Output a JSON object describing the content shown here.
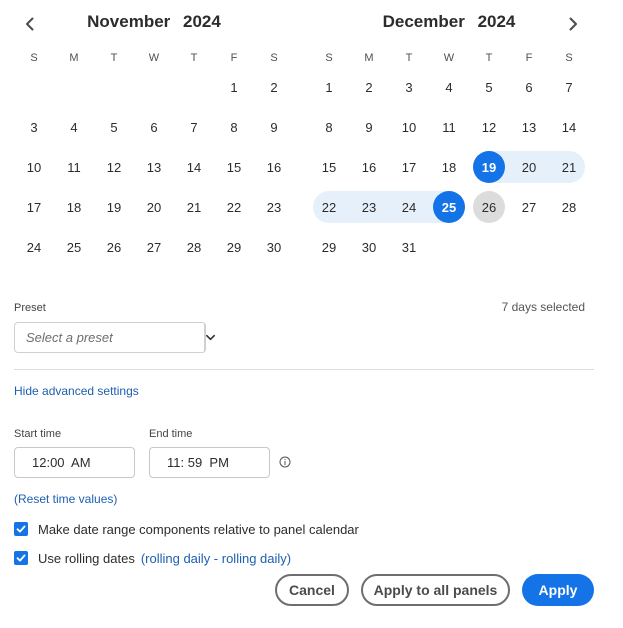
{
  "calendar_left": {
    "month": "November",
    "year": "2024",
    "weekdays": [
      "S",
      "M",
      "T",
      "W",
      "T",
      "F",
      "S"
    ],
    "leading_blanks": 5,
    "days": 30
  },
  "calendar_right": {
    "month": "December",
    "year": "2024",
    "weekdays": [
      "S",
      "M",
      "T",
      "W",
      "T",
      "F",
      "S"
    ],
    "leading_blanks": 0,
    "days": 31,
    "range_start": 19,
    "range_end": 25,
    "today": 26
  },
  "nav": {
    "prev_icon": "chevron-left-icon",
    "next_icon": "chevron-right-icon"
  },
  "preset": {
    "label": "Preset",
    "placeholder": "Select a preset",
    "dropdown_icon": "chevron-down-icon",
    "days_selected": "7 days selected"
  },
  "advanced": {
    "hide_link": "Hide advanced settings",
    "start_label": "Start time",
    "start_value": "12:00  AM",
    "end_label": "End time",
    "end_value": "11: 59  PM",
    "info_icon": "info-icon",
    "reset_link": "(Reset time values)"
  },
  "options": {
    "relative_label": "Make date range components relative to panel calendar",
    "relative_checked": true,
    "rolling_label": "Use rolling dates",
    "rolling_checked": true,
    "rolling_detail": "(rolling daily - rolling daily)"
  },
  "buttons": {
    "cancel": "Cancel",
    "apply_all": "Apply to all panels",
    "apply": "Apply"
  },
  "colors": {
    "accent": "#1473e6",
    "range_fill": "#e6f0fb",
    "today_fill": "#dcdcdc",
    "link": "#1d5fb0"
  }
}
